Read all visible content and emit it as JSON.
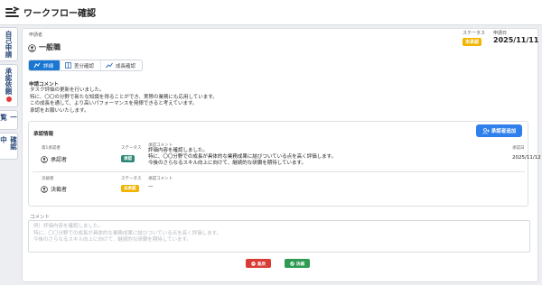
{
  "header": {
    "title": "ワークフロー確認"
  },
  "side_tabs": [
    {
      "label": "自己申請"
    },
    {
      "label": "承認依頼"
    },
    {
      "label": "一覧"
    },
    {
      "label": "確認中"
    }
  ],
  "applicant": {
    "label": "申請者",
    "name": "一般職"
  },
  "status": {
    "label": "ステータス",
    "value": "未承認",
    "color": "#f2b400"
  },
  "apply_date": {
    "label": "申請日",
    "value": "2025/11/11"
  },
  "tabs": [
    {
      "label": "詳細",
      "active": true
    },
    {
      "label": "差分確認",
      "active": false
    },
    {
      "label": "成長確認",
      "active": false
    }
  ],
  "application_comment": {
    "title": "申請コメント",
    "lines": [
      "タスク評価の更新を行いました。",
      "特に、〇〇の分野で新たな知識を得ることができ、実際の業務にも応用しています。",
      "この成長を通して、より高いパフォーマンスを発揮できると考えています。",
      "承認をお願いいたします。"
    ]
  },
  "approval_info": {
    "title": "承認情報",
    "button_label": "承認者追加",
    "rows": [
      {
        "role_label": "第1承認者",
        "person": "承認者",
        "status_label": "ステータス",
        "status": "承認",
        "comment_label": "承認コメント",
        "comment_lines": [
          "評価内容を確認しました。",
          "特に、〇〇分野での成長が具体的な業務成果に結びついている点を高く評価します。",
          "今後のさらなるスキル向上に向けて、継続的な研鑽を期待しています。"
        ],
        "date_label": "承認日",
        "date": "2025/11/12"
      },
      {
        "role_label": "決裁者",
        "person": "決裁者",
        "status_label": "ステータス",
        "status": "未承認",
        "comment_label": "承認コメント",
        "comment_lines": [
          "—"
        ]
      }
    ]
  },
  "comment_input": {
    "label": "コメント",
    "placeholder_lines": [
      "例）評価内容を確認しました。",
      "特に、〇〇分野での成長が具体的な業務成果に結びついている点を高く評価します。",
      "今後のさらなるスキル向上に向けて、継続的な研鑽を期待しています。"
    ]
  },
  "actions": {
    "return_label": "差戻",
    "approve_label": "決裁"
  },
  "colors": {
    "accent": "#1976d2",
    "approved": "#2e8a74",
    "pending": "#f2b400",
    "return": "#d93c35",
    "approve": "#2e9a52",
    "side_tab_text": "#2b4a7a"
  }
}
